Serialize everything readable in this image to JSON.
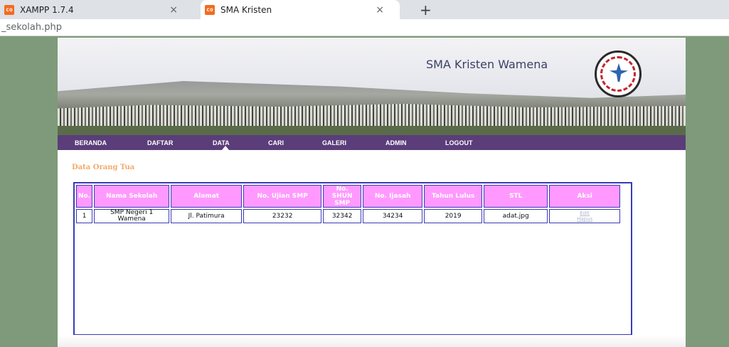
{
  "browser": {
    "tabs": [
      {
        "favicon": "xampp-icon",
        "favicon_text": "co",
        "label": "XAMPP 1.7.4",
        "close": "×"
      },
      {
        "favicon": "xampp-icon",
        "favicon_text": "co",
        "label": "SMA Kristen",
        "close": "×"
      }
    ],
    "new_tab": "+",
    "url": "_sekolah.php"
  },
  "site": {
    "title": "SMA Kristen Wamena",
    "logo_icon": "school-emblem-icon"
  },
  "nav": {
    "items": [
      "BERANDA",
      "DAFTAR",
      "DATA",
      "CARI",
      "GALERI",
      "ADMIN",
      "LOGOUT"
    ],
    "active": "DATA"
  },
  "section_title": "Data Orang Tua",
  "table": {
    "headers": [
      "No.",
      "Nama Sekolah",
      "Alamat",
      "No. Ujian SMP",
      "No. SHUN SMP",
      "No. Ijasah",
      "Tahun Lulus",
      "STL",
      "Aksi"
    ],
    "rows": [
      {
        "no": "1",
        "nama_sekolah": "SMP Negeri 1 Wamena",
        "alamat": "Jl. Patimura",
        "no_ujian": "23232",
        "no_shun": "32342",
        "no_ijasah": "34234",
        "tahun_lulus": "2019",
        "stl": "adat.jpg",
        "aksi_edit": "Edit",
        "aksi_hapus": "Hapus"
      }
    ]
  },
  "colors": {
    "nav_bg": "#5b3d7a",
    "header_cell": "#ff99ff",
    "table_border": "#3a3ab8",
    "section_title": "#f3a86a",
    "page_bg": "#7f9a7b"
  }
}
